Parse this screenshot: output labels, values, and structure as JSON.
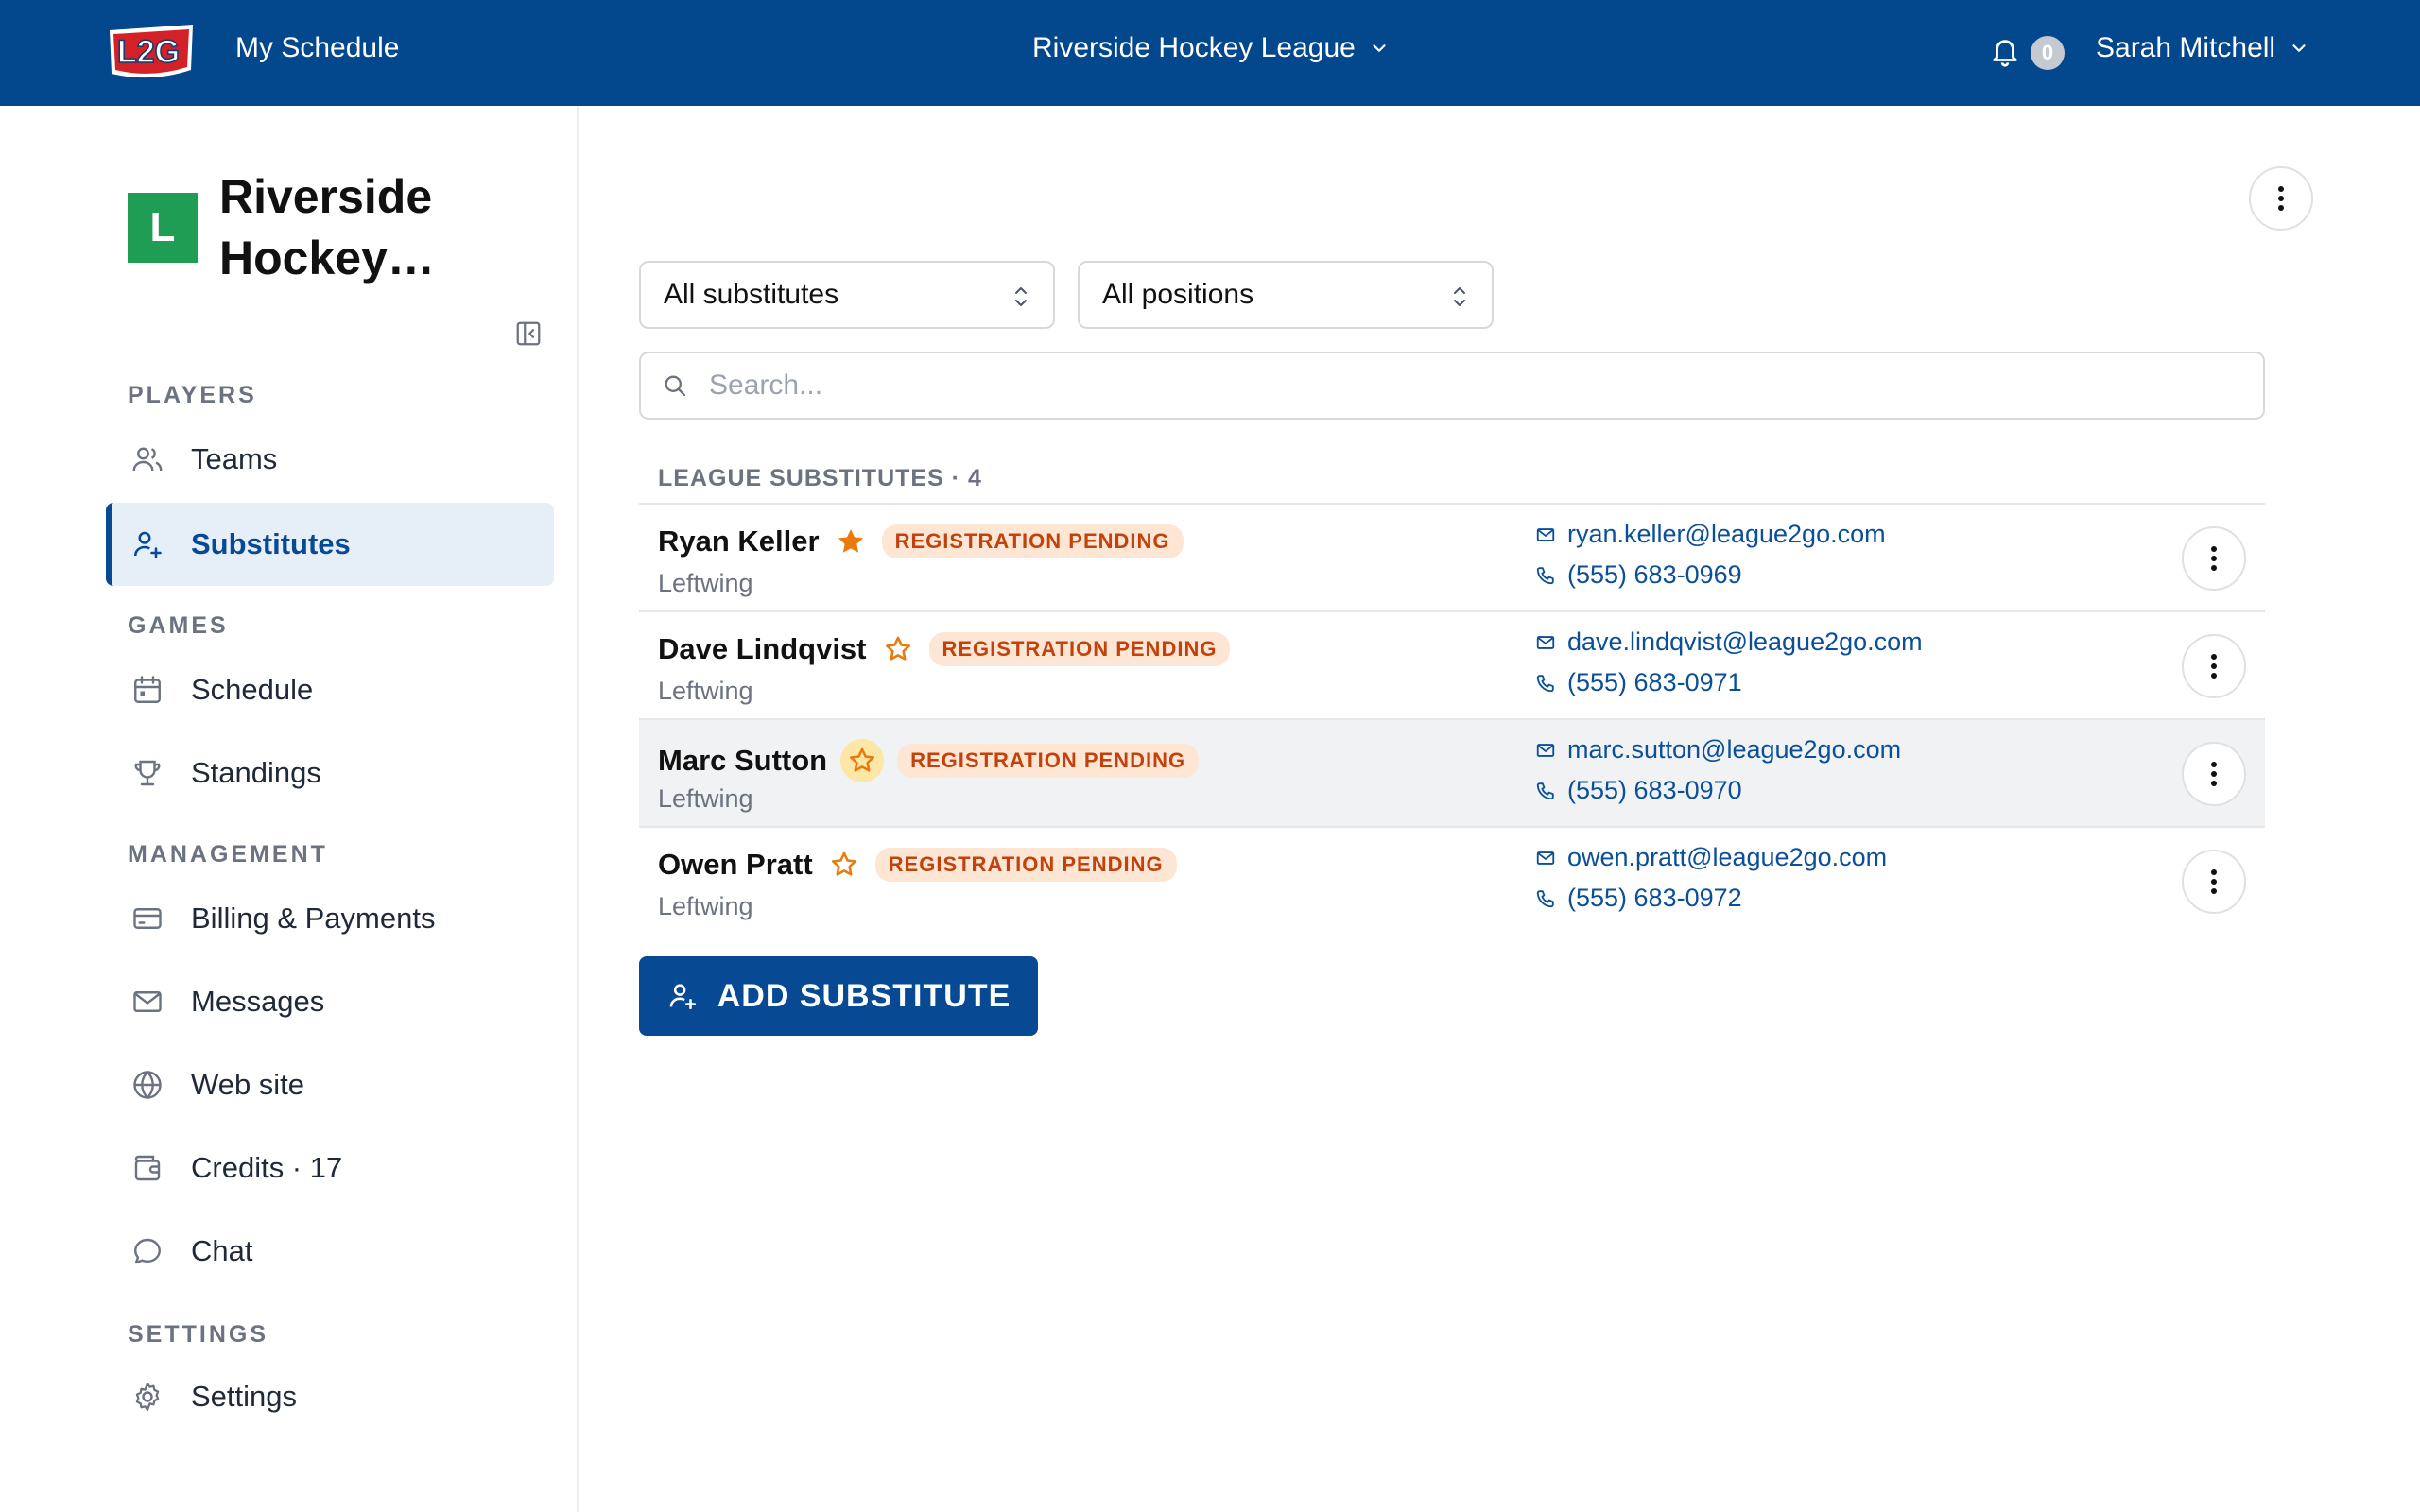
{
  "topbar": {
    "logo_text": "L2G",
    "my_schedule": "My Schedule",
    "league_name": "Riverside Hockey League",
    "notification_count": "0",
    "user_name": "Sarah Mitchell"
  },
  "sidebar": {
    "org_initial": "L",
    "org_name": "Riverside Hockey…",
    "sections": {
      "players": "PLAYERS",
      "games": "GAMES",
      "management": "MANAGEMENT",
      "settings": "SETTINGS"
    },
    "items": {
      "teams": "Teams",
      "substitutes": "Substitutes",
      "schedule": "Schedule",
      "standings": "Standings",
      "billing": "Billing & Payments",
      "messages": "Messages",
      "website": "Web site",
      "credits": "Credits · 17",
      "chat": "Chat",
      "settings": "Settings"
    }
  },
  "filters": {
    "substitutes_filter": "All substitutes",
    "positions_filter": "All positions",
    "search_placeholder": "Search..."
  },
  "list": {
    "header": "LEAGUE SUBSTITUTES · 4",
    "rows": [
      {
        "name": "Ryan Keller",
        "status": "REGISTRATION PENDING",
        "position": "Leftwing",
        "email": "ryan.keller@league2go.com",
        "phone": "(555) 683-0969",
        "starred": true
      },
      {
        "name": "Dave Lindqvist",
        "status": "REGISTRATION PENDING",
        "position": "Leftwing",
        "email": "dave.lindqvist@league2go.com",
        "phone": "(555) 683-0971",
        "starred": false
      },
      {
        "name": "Marc Sutton",
        "status": "REGISTRATION PENDING",
        "position": "Leftwing",
        "email": "marc.sutton@league2go.com",
        "phone": "(555) 683-0970",
        "starred": false
      },
      {
        "name": "Owen Pratt",
        "status": "REGISTRATION PENDING",
        "position": "Leftwing",
        "email": "owen.pratt@league2go.com",
        "phone": "(555) 683-0972",
        "starred": false
      }
    ]
  },
  "actions": {
    "add_substitute": "ADD SUBSTITUTE"
  },
  "colors": {
    "brand": "#03478c",
    "accent": "#074a93",
    "star_filled": "#ea7a0c",
    "status_text": "#c2410c",
    "status_bg": "#fde6d4"
  }
}
